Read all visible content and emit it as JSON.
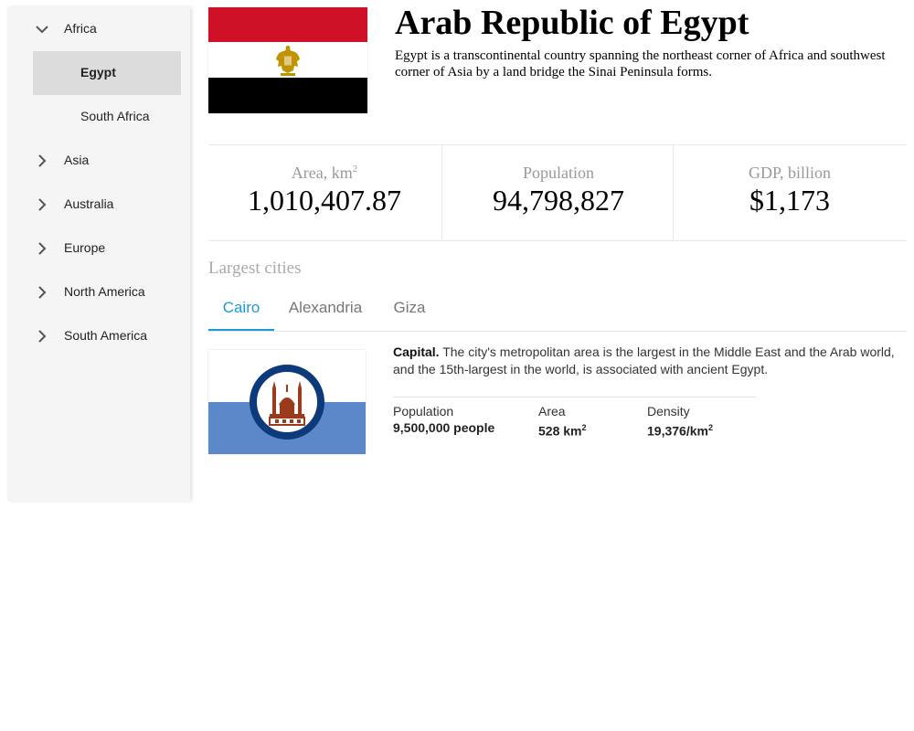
{
  "sidebar": {
    "continents": [
      {
        "label": "Africa",
        "expanded": true,
        "children": [
          {
            "label": "Egypt",
            "selected": true
          },
          {
            "label": "South Africa",
            "selected": false
          }
        ]
      },
      {
        "label": "Asia",
        "expanded": false
      },
      {
        "label": "Australia",
        "expanded": false
      },
      {
        "label": "Europe",
        "expanded": false
      },
      {
        "label": "North America",
        "expanded": false
      },
      {
        "label": "South America",
        "expanded": false
      }
    ]
  },
  "country": {
    "title": "Arab Republic of Egypt",
    "description": "Egypt is a transcontinental country spanning the northeast corner of Africa and southwest corner of Asia by a land bridge the Sinai Peninsula forms.",
    "flag_colors": {
      "top": "#ce1126",
      "middle": "#ffffff",
      "bottom": "#000000",
      "eagle": "#c09300"
    },
    "stats": {
      "area": {
        "label": "Area, km",
        "sup": "2",
        "value": "1,010,407.87"
      },
      "population": {
        "label": "Population",
        "value": "94,798,827"
      },
      "gdp": {
        "label": "GDP, billion",
        "value": "$1,173"
      }
    }
  },
  "cities": {
    "section_title": "Largest cities",
    "tabs": [
      "Cairo",
      "Alexandria",
      "Giza"
    ],
    "active_tab": "Cairo",
    "accent_color": "#1a9bd7",
    "selected": {
      "lead": "Capital.",
      "description": " The city's metropolitan area is the largest in the Middle East and the Arab world, and the 15th-largest in the world, is associated with ancient Egypt.",
      "flag_colors": {
        "top": "#ffffff",
        "bottom": "#5b88c9",
        "ring": "#0d3a7a",
        "emblem": "#9c3a1c"
      },
      "stats": {
        "population": {
          "label": "Population",
          "value": "9,500,000 people"
        },
        "area": {
          "label": "Area",
          "value": "528 km",
          "sup": "2"
        },
        "density": {
          "label": "Density",
          "value": "19,376/km",
          "sup": "2"
        }
      }
    }
  }
}
